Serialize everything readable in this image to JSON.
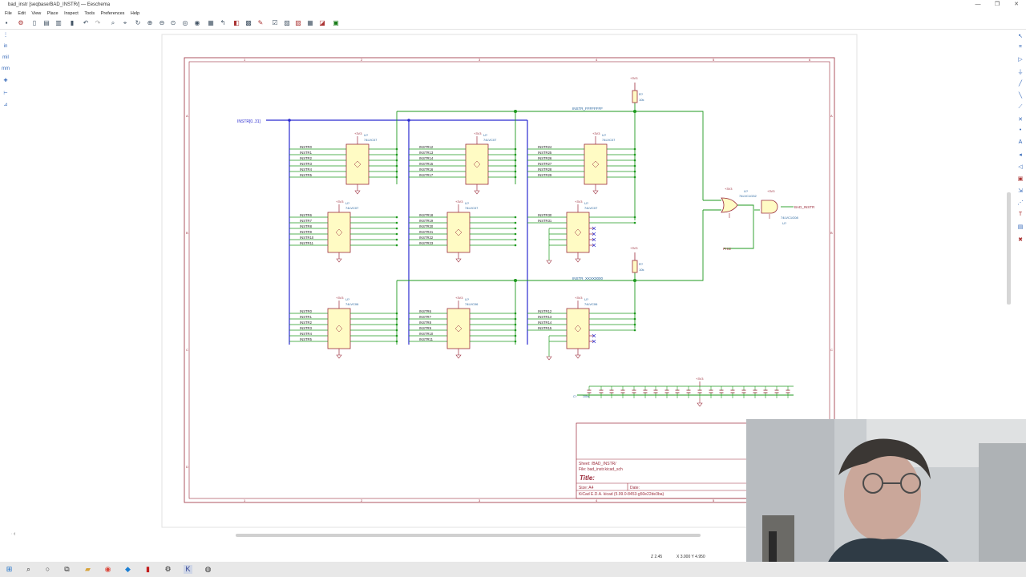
{
  "window": {
    "title": "bad_instr [seqbase/BAD_INSTR/] — Eeschema",
    "controls": [
      "—",
      "❐",
      "✕"
    ]
  },
  "menu": [
    "File",
    "Edit",
    "View",
    "Place",
    "Inspect",
    "Tools",
    "Preferences",
    "Help"
  ],
  "left_toolbar": [
    "in",
    "mil",
    "mm"
  ],
  "schematic": {
    "bus_label": "INSTR[0..31]",
    "net_ffffff": "INSTR_FFFFFFFF",
    "net_xxxx": "INSTR_XXXX0000",
    "out_label": "BAD_INSTR",
    "phi_label": "PHI2",
    "pwr": "+3V3",
    "r_top": {
      "ref": "R?",
      "val": "10k"
    },
    "r_mid": {
      "ref": "R?",
      "val": "10k"
    },
    "col_numbers": [
      "1",
      "2",
      "3",
      "4",
      "5",
      "6"
    ],
    "row_letters": [
      "A",
      "B",
      "C",
      "D"
    ],
    "and_gate": {
      "ref": "U?",
      "val": "74LVC1G08"
    },
    "or_gate": {
      "ref": "U?",
      "val": "74LVC1G32"
    },
    "chips_top": [
      {
        "ref": "U?",
        "val": "74LVC07",
        "inputs": [
          "INSTR0",
          "INSTR1",
          "INSTR2",
          "INSTR3",
          "INSTR4",
          "INSTR5"
        ]
      },
      {
        "ref": "U?",
        "val": "74LVC07",
        "inputs": [
          "INSTR12",
          "INSTR13",
          "INSTR14",
          "INSTR15",
          "INSTR16",
          "INSTR17"
        ]
      },
      {
        "ref": "U?",
        "val": "74LVC07",
        "inputs": [
          "INSTR24",
          "INSTR25",
          "INSTR26",
          "INSTR27",
          "INSTR28",
          "INSTR29"
        ]
      }
    ],
    "chips_mid": [
      {
        "ref": "U?",
        "val": "74LVC07",
        "inputs": [
          "INSTR6",
          "INSTR7",
          "INSTR8",
          "INSTR9",
          "INSTR10",
          "INSTR11"
        ]
      },
      {
        "ref": "U?",
        "val": "74LVC07",
        "inputs": [
          "INSTR18",
          "INSTR19",
          "INSTR20",
          "INSTR21",
          "INSTR22",
          "INSTR23"
        ]
      },
      {
        "ref": "U?",
        "val": "74LVC07",
        "inputs": [
          "INSTR30",
          "INSTR31"
        ]
      }
    ],
    "chips_bot": [
      {
        "ref": "U?",
        "val": "74LVC06",
        "inputs": [
          "INSTR0",
          "INSTR1",
          "INSTR2",
          "INSTR3",
          "INSTR4",
          "INSTR5"
        ]
      },
      {
        "ref": "U?",
        "val": "74LVC06",
        "inputs": [
          "INSTR6",
          "INSTR7",
          "INSTR8",
          "INSTR9",
          "INSTR10",
          "INSTR11"
        ]
      },
      {
        "ref": "U?",
        "val": "74LVC06",
        "inputs": [
          "INSTR12",
          "INSTR13",
          "INSTR14",
          "INSTR15"
        ]
      }
    ],
    "cap_row": {
      "ref": "C?",
      "val": "100n"
    },
    "title_block": {
      "sheet": "Sheet: /BAD_INSTR/",
      "file": "File: bad_instr.kicad_sch",
      "title": "Title:",
      "size": "Size: A4",
      "date": "Date:",
      "kicad": "KiCad E.D.A.  kicad (5.99.0-8453-g50e22de3ba)"
    }
  },
  "status": {
    "zoom": "Z 2.45",
    "coords": "X 3.000  Y 4.950"
  },
  "taskbar": [
    "windows",
    "search",
    "task-view",
    "file-explorer",
    "chrome",
    "vscode",
    "app",
    "settings",
    "kicad",
    "other"
  ]
}
